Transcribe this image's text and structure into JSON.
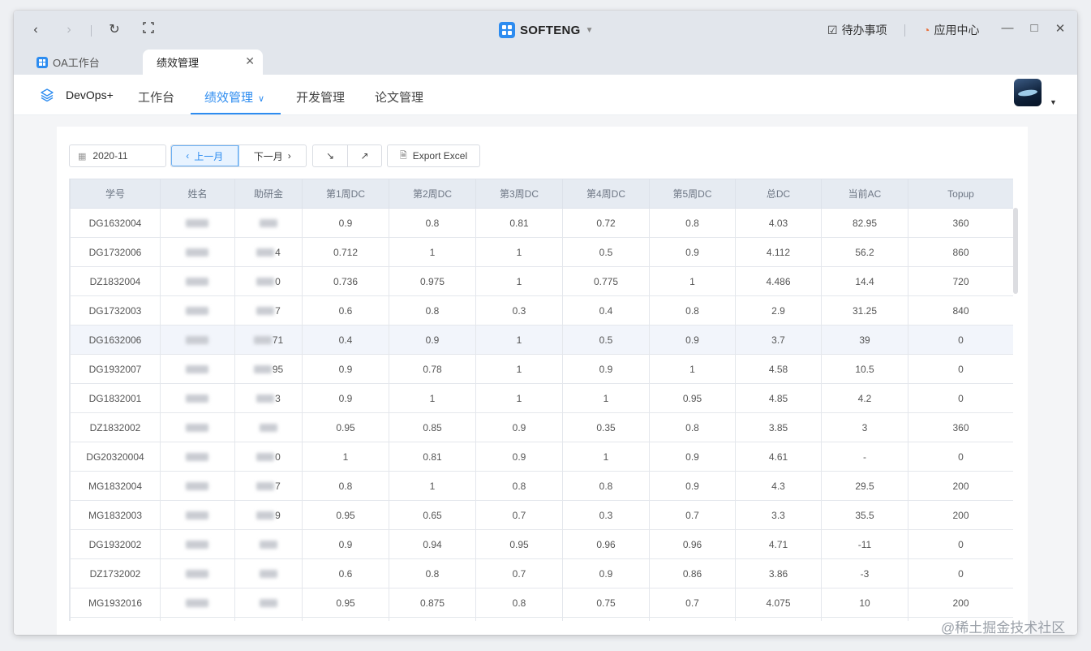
{
  "titlebar": {
    "brand": "SOFTENG",
    "todo_label": "待办事项",
    "appcenter_label": "应用中心"
  },
  "tabs": [
    {
      "label": "OA工作台"
    },
    {
      "label": "绩效管理"
    }
  ],
  "nav": {
    "product": "DevOps+",
    "items": [
      "工作台",
      "绩效管理",
      "开发管理",
      "论文管理"
    ]
  },
  "toolbar": {
    "month": "2020-11",
    "prev_label": "上一月",
    "next_label": "下一月",
    "export_label": "Export Excel"
  },
  "table": {
    "headers": [
      "学号",
      "姓名",
      "助研金",
      "第1周DC",
      "第2周DC",
      "第3周DC",
      "第4周DC",
      "第5周DC",
      "总DC",
      "当前AC",
      "Topup"
    ],
    "rows": [
      {
        "id": "DG1632004",
        "name": "",
        "grant": "",
        "w1": "0.9",
        "w2": "0.8",
        "w3": "0.81",
        "w4": "0.72",
        "w5": "0.8",
        "total": "4.03",
        "ac": "82.95",
        "topup": "360"
      },
      {
        "id": "DG1732006",
        "name": "",
        "grant": "4",
        "w1": "0.712",
        "w2": "1",
        "w3": "1",
        "w4": "0.5",
        "w5": "0.9",
        "total": "4.112",
        "ac": "56.2",
        "topup": "860"
      },
      {
        "id": "DZ1832004",
        "name": "",
        "grant": "0",
        "w1": "0.736",
        "w2": "0.975",
        "w3": "1",
        "w4": "0.775",
        "w5": "1",
        "total": "4.486",
        "ac": "14.4",
        "topup": "720"
      },
      {
        "id": "DG1732003",
        "name": "",
        "grant": "7",
        "w1": "0.6",
        "w2": "0.8",
        "w3": "0.3",
        "w4": "0.4",
        "w5": "0.8",
        "total": "2.9",
        "ac": "31.25",
        "topup": "840"
      },
      {
        "id": "DG1632006",
        "name": "",
        "grant": "71",
        "w1": "0.4",
        "w2": "0.9",
        "w3": "1",
        "w4": "0.5",
        "w5": "0.9",
        "total": "3.7",
        "ac": "39",
        "topup": "0"
      },
      {
        "id": "DG1932007",
        "name": "",
        "grant": "95",
        "w1": "0.9",
        "w2": "0.78",
        "w3": "1",
        "w4": "0.9",
        "w5": "1",
        "total": "4.58",
        "ac": "10.5",
        "topup": "0"
      },
      {
        "id": "DG1832001",
        "name": "",
        "grant": "3",
        "w1": "0.9",
        "w2": "1",
        "w3": "1",
        "w4": "1",
        "w5": "0.95",
        "total": "4.85",
        "ac": "4.2",
        "topup": "0"
      },
      {
        "id": "DZ1832002",
        "name": "",
        "grant": "",
        "w1": "0.95",
        "w2": "0.85",
        "w3": "0.9",
        "w4": "0.35",
        "w5": "0.8",
        "total": "3.85",
        "ac": "3",
        "topup": "360"
      },
      {
        "id": "DG20320004",
        "name": "",
        "grant": "0",
        "w1": "1",
        "w2": "0.81",
        "w3": "0.9",
        "w4": "1",
        "w5": "0.9",
        "total": "4.61",
        "ac": "-",
        "topup": "0"
      },
      {
        "id": "MG1832004",
        "name": "",
        "grant": "7",
        "w1": "0.8",
        "w2": "1",
        "w3": "0.8",
        "w4": "0.8",
        "w5": "0.9",
        "total": "4.3",
        "ac": "29.5",
        "topup": "200"
      },
      {
        "id": "MG1832003",
        "name": "",
        "grant": "9",
        "w1": "0.95",
        "w2": "0.65",
        "w3": "0.7",
        "w4": "0.3",
        "w5": "0.7",
        "total": "3.3",
        "ac": "35.5",
        "topup": "200"
      },
      {
        "id": "DG1932002",
        "name": "",
        "grant": "",
        "w1": "0.9",
        "w2": "0.94",
        "w3": "0.95",
        "w4": "0.96",
        "w5": "0.96",
        "total": "4.71",
        "ac": "-11",
        "topup": "0"
      },
      {
        "id": "DZ1732002",
        "name": "",
        "grant": "",
        "w1": "0.6",
        "w2": "0.8",
        "w3": "0.7",
        "w4": "0.9",
        "w5": "0.86",
        "total": "3.86",
        "ac": "-3",
        "topup": "0"
      },
      {
        "id": "MG1932016",
        "name": "",
        "grant": "",
        "w1": "0.95",
        "w2": "0.875",
        "w3": "0.8",
        "w4": "0.75",
        "w5": "0.7",
        "total": "4.075",
        "ac": "10",
        "topup": "200"
      }
    ]
  },
  "watermark": "@稀土掘金技术社区",
  "colors": {
    "accent": "#2d8cf0",
    "header_bg": "#e6ebf2",
    "row_highlight": "#f2f5fb"
  }
}
